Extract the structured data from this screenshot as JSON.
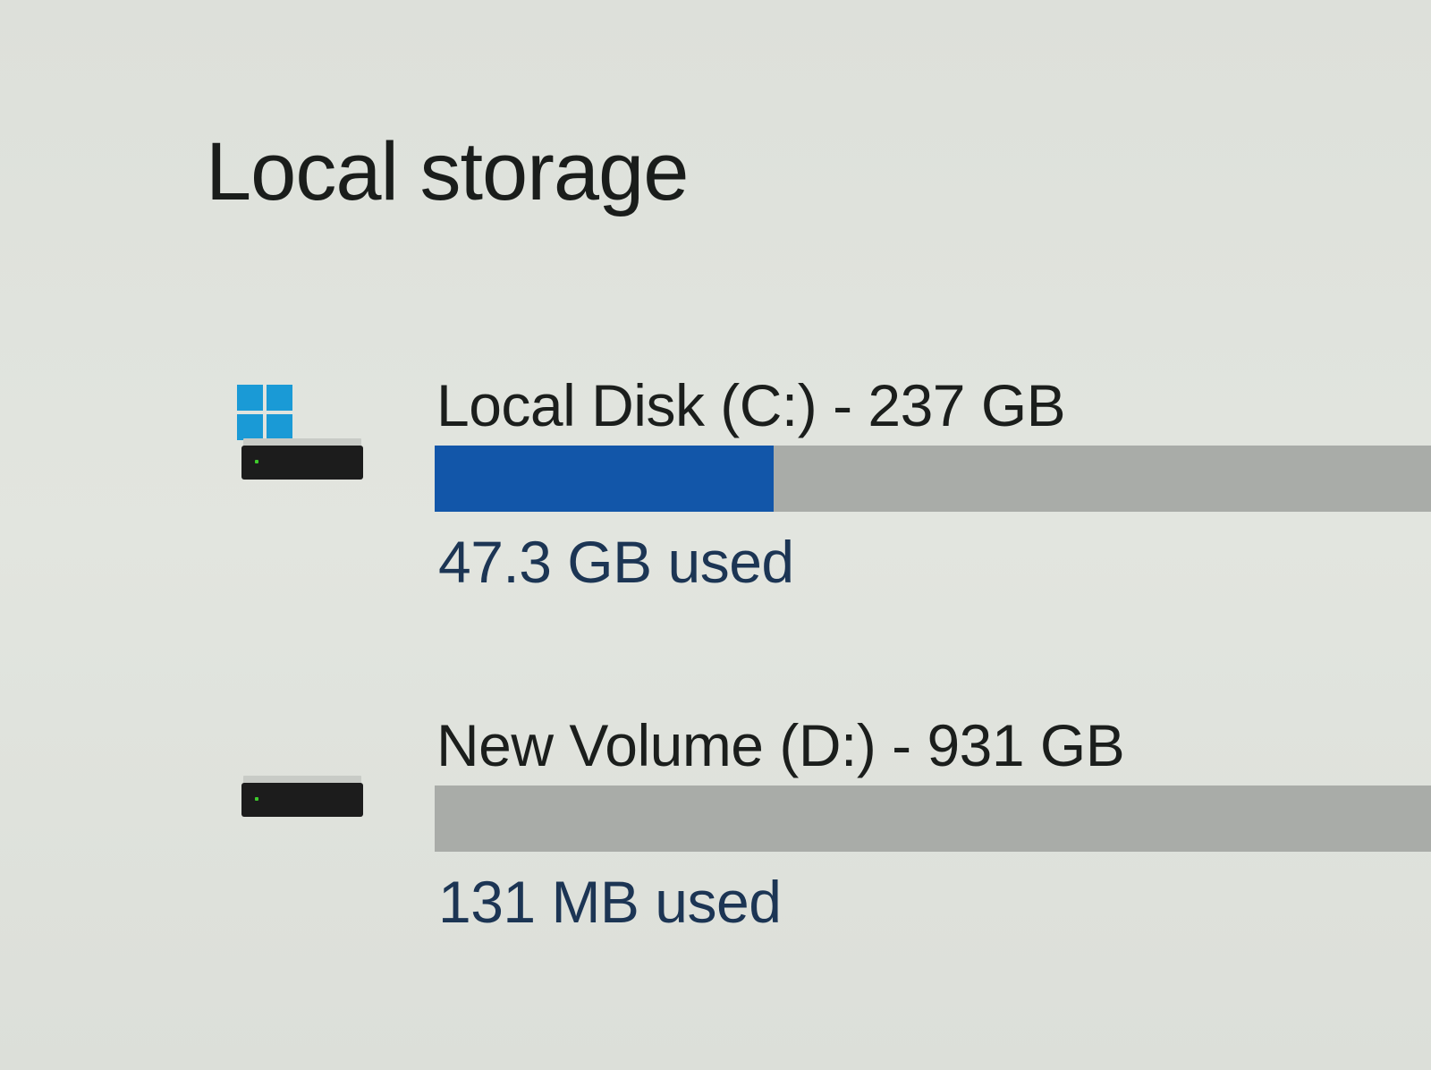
{
  "section": {
    "title": "Local storage"
  },
  "drives": [
    {
      "name": "Local Disk (C:) - 237 GB",
      "used_label": "47.3 GB used",
      "used_fraction": 0.34,
      "icon": "windows-drive-icon",
      "fill_color": "#1256a9"
    },
    {
      "name": "New Volume (D:) - 931 GB",
      "used_label": "131 MB used",
      "used_fraction": 0.0,
      "icon": "drive-icon",
      "fill_color": "#1256a9"
    }
  ],
  "colors": {
    "accent": "#1256a9",
    "track": "#a9aca8",
    "windows_logo": "#1a9ad6"
  }
}
